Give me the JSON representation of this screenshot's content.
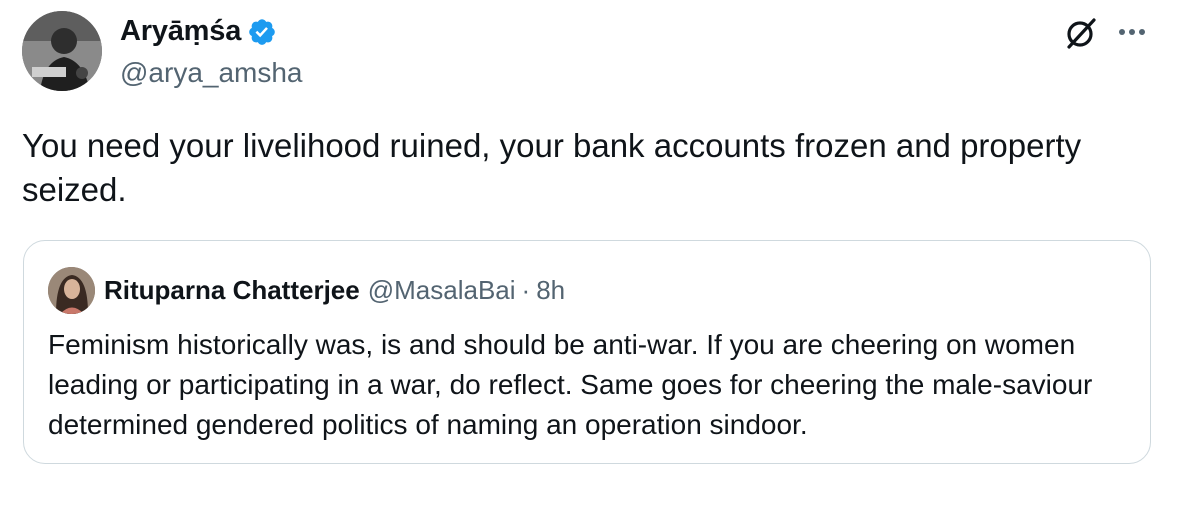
{
  "tweet": {
    "author_name": "Aryāṃśa",
    "author_handle": "@arya_amsha",
    "text": "You need your livelihood ruined, your bank accounts frozen and property seized."
  },
  "quote": {
    "author_name": "Rituparna Chatterjee",
    "author_handle": "@MasalaBai",
    "separator": "·",
    "time": "8h",
    "text": "Feminism historically was, is and should be anti-war. If you are cheering on women leading or participating in a war, do reflect. Same goes for cheering the male-saviour determined gendered politics of naming an operation sindoor."
  },
  "icons": {
    "verified": "verified-badge-icon",
    "grok": "grok-icon",
    "more": "more-options-icon"
  },
  "colors": {
    "verified": "#1d9bf0",
    "secondary_text": "#536471",
    "border": "#cfd9de"
  }
}
